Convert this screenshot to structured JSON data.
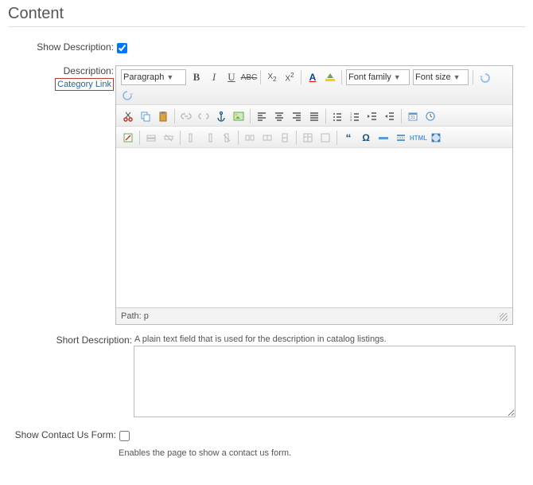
{
  "panel": {
    "title": "Content"
  },
  "show_desc": {
    "label": "Show Description:",
    "checked": true
  },
  "desc": {
    "label": "Description:"
  },
  "category_link": {
    "label": "Category Link"
  },
  "editor": {
    "block_sel": "Paragraph",
    "font_family_sel": "Font family",
    "font_size_sel": "Font size",
    "path_label": "Path: p"
  },
  "short_desc": {
    "label": "Short Description:",
    "help": "A plain text field that is used for the description in catalog listings."
  },
  "contact": {
    "label": "Show Contact Us Form:",
    "help": "Enables the page to show a contact us form.",
    "checked": false
  }
}
